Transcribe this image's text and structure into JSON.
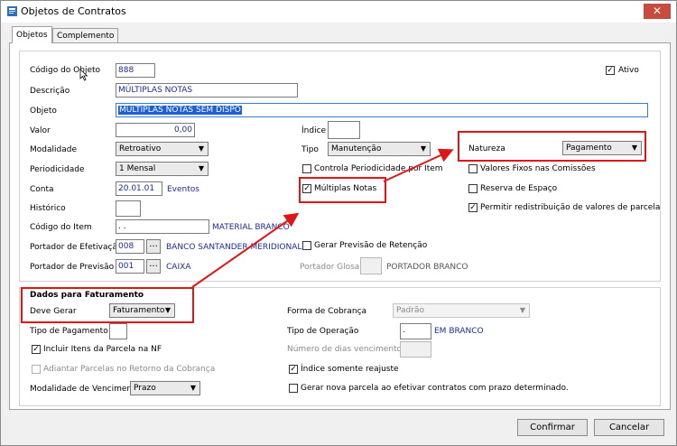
{
  "window": {
    "title": "Objetos de Contratos",
    "close": "✕"
  },
  "tabs": [
    {
      "label": "Objetos"
    },
    {
      "label": "Complemento"
    }
  ],
  "fields": {
    "codigo_objeto": {
      "label": "Código do Objeto",
      "value": "888"
    },
    "ativo": {
      "label": "Ativo",
      "checked": "✓"
    },
    "descricao": {
      "label": "Descrição",
      "value": "MÚLTIPLAS NOTAS"
    },
    "objeto": {
      "label": "Objeto",
      "value": "MÚLTIPLAS NOTAS SEM DISPO"
    },
    "valor": {
      "label": "Valor",
      "value": "0,00"
    },
    "indice": {
      "label": "Índice",
      "value": ""
    },
    "modalidade": {
      "label": "Modalidade",
      "value": "Retroativo"
    },
    "tipo": {
      "label": "Tipo",
      "value": "Manutenção"
    },
    "natureza": {
      "label": "Natureza",
      "value": "Pagamento"
    },
    "periodicidade": {
      "label": "Periodicidade",
      "value": "1 Mensal"
    },
    "controla_periodicidade": {
      "label": "Controla Periodicidade por Item"
    },
    "valores_fixos": {
      "label": "Valores Fixos nas Comissões"
    },
    "conta": {
      "label": "Conta",
      "value": "20.01.01",
      "desc": "Eventos"
    },
    "multiplas_notas": {
      "label": "Múltiplas Notas",
      "checked": "✓"
    },
    "reserva_espaco": {
      "label": "Reserva de Espaço"
    },
    "historico": {
      "label": "Histórico",
      "value": ""
    },
    "permitir_redistribuir": {
      "label": "Permitir redistribuição de valores de parcela",
      "checked": "✓"
    },
    "codigo_item": {
      "label": "Código do Item",
      "value": ".  .",
      "desc": "MATERIAL BRANCO"
    },
    "portador_efetivacao": {
      "label": "Portador de Efetivação",
      "value": "008",
      "desc": "BANCO SANTANDER MERIDIONAL"
    },
    "gerar_previsao": {
      "label": "Gerar Previsão de  Retenção"
    },
    "portador_previsao": {
      "label": "Portador de Previsão",
      "value": "001",
      "desc": "CAIXA"
    },
    "portador_glosa": {
      "label": "Portador Glosa",
      "value": "",
      "desc": "PORTADOR BRANCO"
    }
  },
  "faturamento": {
    "title": "Dados para Faturamento",
    "deve_gerar": {
      "label": "Deve Gerar",
      "value": "Faturamento"
    },
    "forma_cobranca": {
      "label": "Forma de Cobrança",
      "value": "Padrão"
    },
    "tipo_pagamento": {
      "label": "Tipo de Pagamento",
      "value": ""
    },
    "tipo_operacao": {
      "label": "Tipo de Operação",
      "value": ".",
      "desc": "EM BRANCO"
    },
    "numero_dias": {
      "label": "Número de dias vencimento",
      "value": ""
    },
    "incluir_itens": {
      "label": "Incluir Itens da Parcela na NF",
      "checked": "✓"
    },
    "indice_reajuste": {
      "label": "Índice somente reajuste",
      "checked": "✓"
    },
    "adiantar_parcelas": {
      "label": "Adiantar Parcelas no Retorno da Cobrança"
    },
    "modalidade_vencimento": {
      "label": "Modalidade de Vencimento",
      "value": "Prazo"
    },
    "gerar_nova_parcela": {
      "label": "Gerar nova parcela ao efetivar contratos com prazo determinado."
    }
  },
  "buttons": {
    "confirmar": "Confirmar",
    "cancelar": "Cancelar",
    "lookup": "..."
  },
  "colors": {
    "accent_text": "#1c2a9c",
    "highlight": "#e01515",
    "selection": "#1e5fd6"
  }
}
